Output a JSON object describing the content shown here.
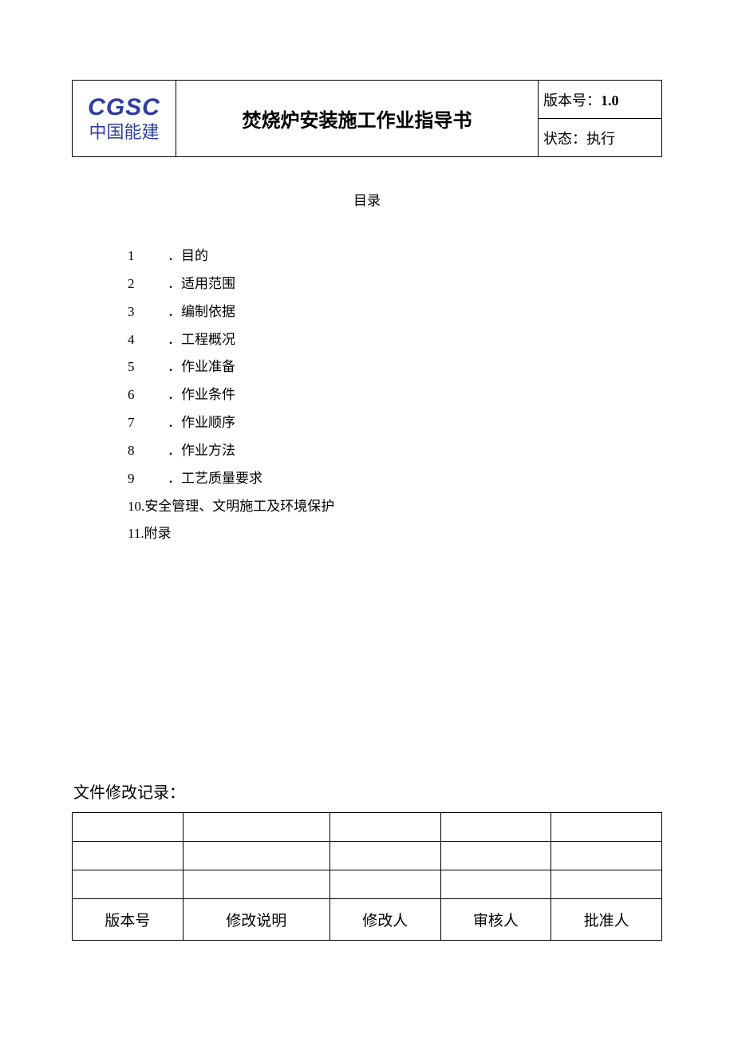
{
  "header": {
    "logo_en": "CGSC",
    "logo_cn": "中国能建",
    "title": "焚烧炉安装施工作业指导书",
    "version_label": "版本号：",
    "version_value": "1.0",
    "status_label": "状态：",
    "status_value": "执行"
  },
  "toc": {
    "heading": "目录",
    "items": [
      {
        "num": "1",
        "label": "．目的"
      },
      {
        "num": "2",
        "label": "．适用范围"
      },
      {
        "num": "3",
        "label": "．编制依据"
      },
      {
        "num": "4",
        "label": "．工程概况"
      },
      {
        "num": "5",
        "label": "．作业准备"
      },
      {
        "num": "6",
        "label": "．作业条件"
      },
      {
        "num": "7",
        "label": "．作业顺序"
      },
      {
        "num": "8",
        "label": "．作业方法"
      },
      {
        "num": "9",
        "label": "．工艺质量要求"
      }
    ],
    "items_wide": [
      {
        "text": "10.安全管理、文明施工及环境保护"
      },
      {
        "text": "11.附录"
      }
    ]
  },
  "revision": {
    "label": "文件修改记录：",
    "columns": [
      "版本号",
      "修改说明",
      "修改人",
      "审核人",
      "批准人"
    ]
  }
}
